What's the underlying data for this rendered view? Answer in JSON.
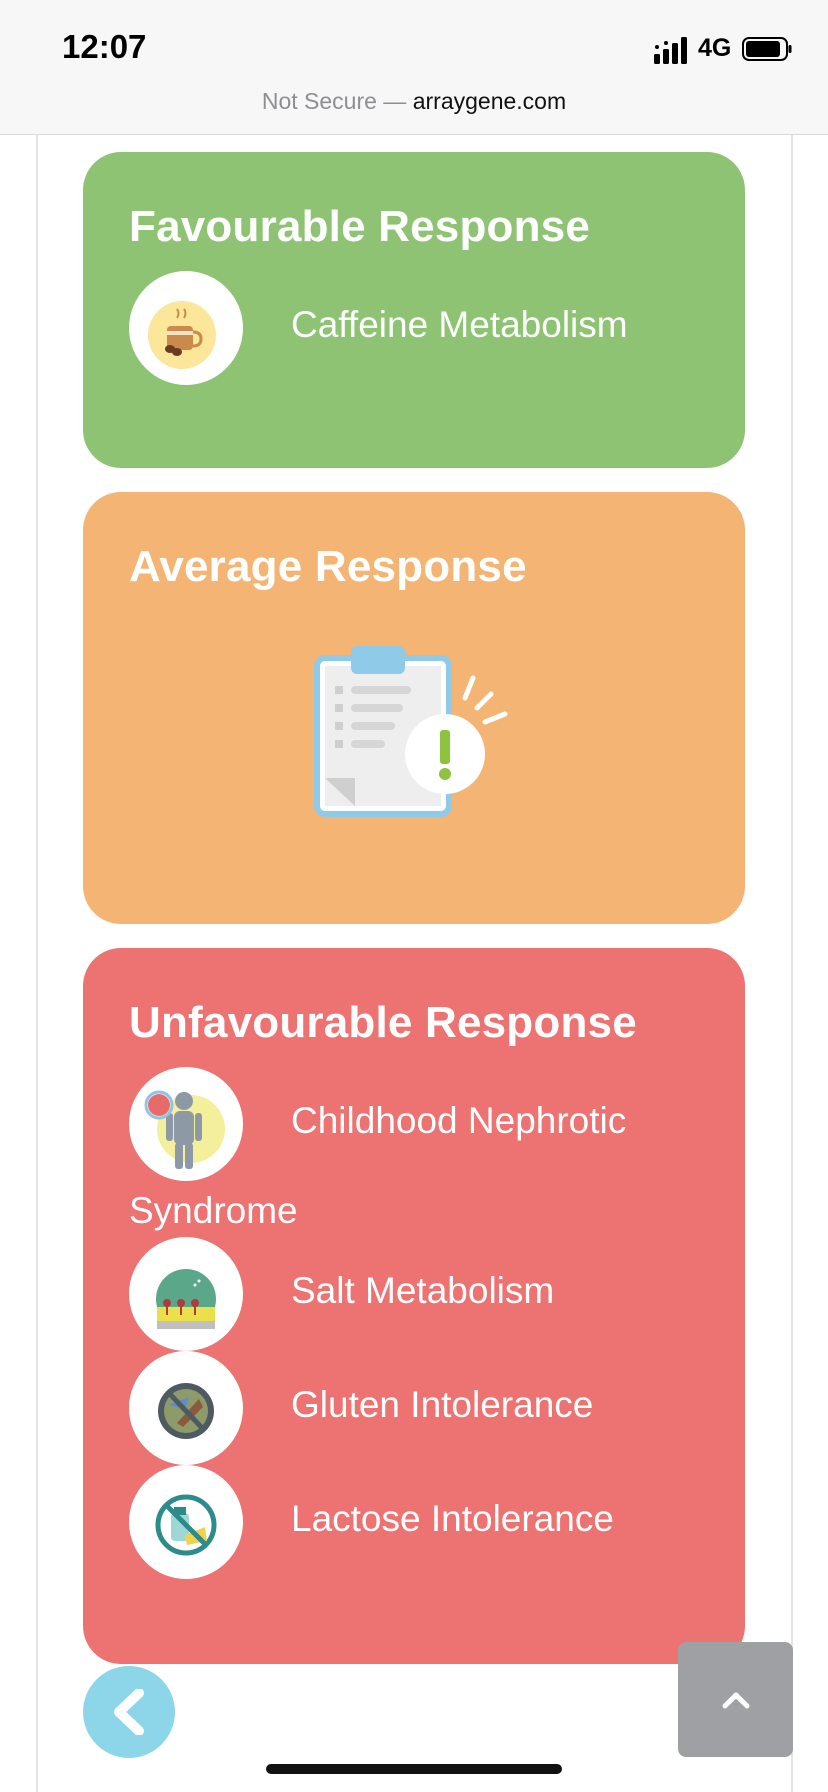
{
  "status_bar": {
    "time": "12:07",
    "network": "4G"
  },
  "address_bar": {
    "prefix": "Not Secure —",
    "host": "arraygene.com"
  },
  "favourable": {
    "title": "Favourable Response",
    "items": [
      {
        "label": "Caffeine Metabolism",
        "icon": "coffee-cup-icon"
      }
    ]
  },
  "average": {
    "title": "Average Response",
    "icon": "clipboard-alert-icon"
  },
  "unfavourable": {
    "title": "Unfavourable Response",
    "items": [
      {
        "label": "Childhood Nephrotic",
        "label_wrap": "Syndrome",
        "icon": "kidney-body-icon"
      },
      {
        "label": "Salt Metabolism",
        "icon": "salt-shaker-icon"
      },
      {
        "label": "Gluten Intolerance",
        "icon": "no-gluten-icon"
      },
      {
        "label": "Lactose Intolerance",
        "icon": "no-lactose-icon"
      }
    ]
  },
  "controls": {
    "back_icon": "chevron-left-icon",
    "top_icon": "chevron-up-icon"
  },
  "colors": {
    "favourable": "#8ec374",
    "average": "#f3b474",
    "unfavourable": "#ec7371",
    "back": "#8dd5e8",
    "top": "#9ea0a3"
  }
}
